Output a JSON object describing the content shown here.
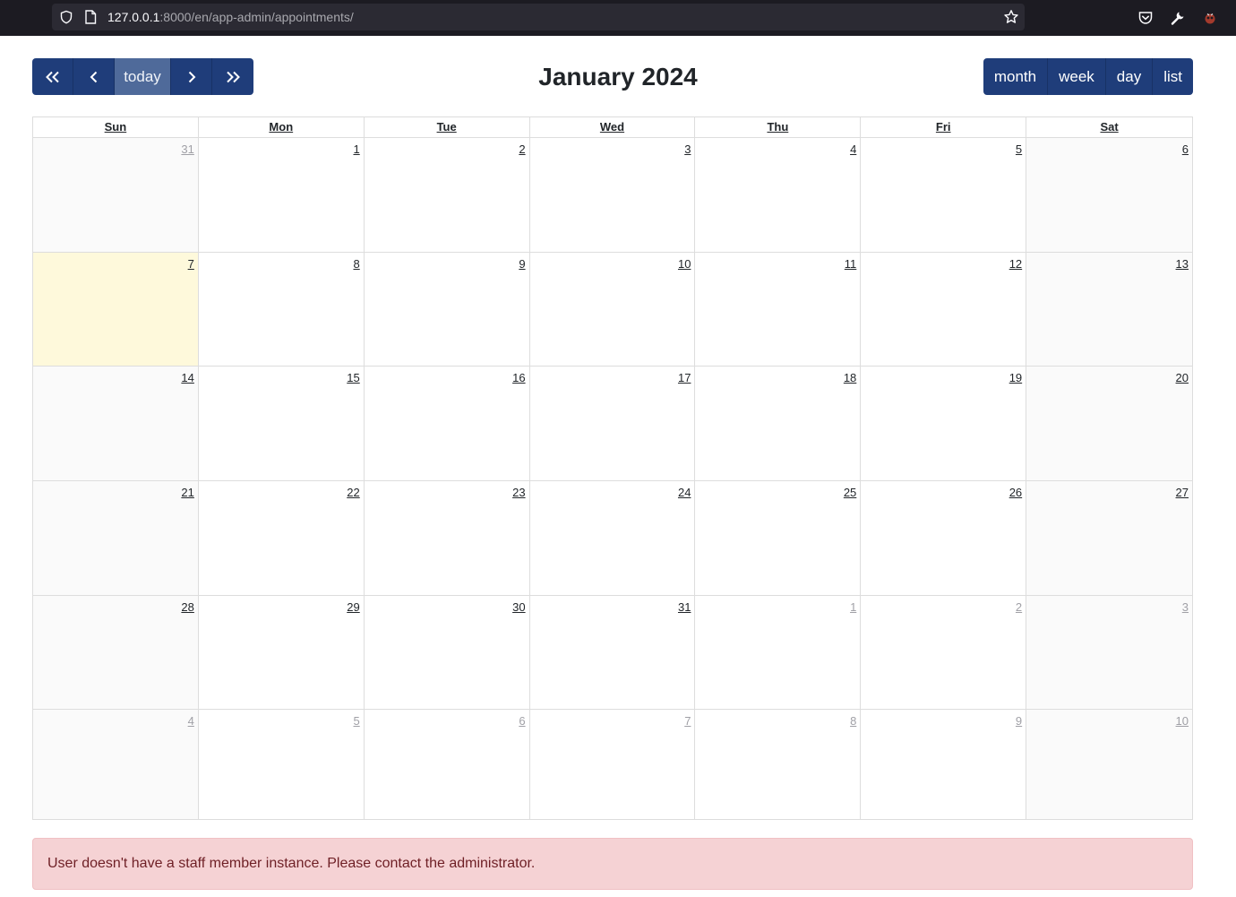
{
  "browser": {
    "url_host": "127.0.0.1",
    "url_path": ":8000/en/app-admin/appointments/"
  },
  "toolbar": {
    "prev_year_label": "«",
    "prev_label": "‹",
    "today_label": "today",
    "next_label": "›",
    "next_year_label": "»",
    "title": "January 2024",
    "views": [
      "month",
      "week",
      "day",
      "list"
    ]
  },
  "calendar": {
    "weekdays": [
      "Sun",
      "Mon",
      "Tue",
      "Wed",
      "Thu",
      "Fri",
      "Sat"
    ],
    "today": "7",
    "weeks": [
      [
        {
          "d": "31",
          "other": true
        },
        {
          "d": "1"
        },
        {
          "d": "2"
        },
        {
          "d": "3"
        },
        {
          "d": "4"
        },
        {
          "d": "5"
        },
        {
          "d": "6"
        }
      ],
      [
        {
          "d": "7",
          "today": true
        },
        {
          "d": "8"
        },
        {
          "d": "9"
        },
        {
          "d": "10"
        },
        {
          "d": "11"
        },
        {
          "d": "12"
        },
        {
          "d": "13"
        }
      ],
      [
        {
          "d": "14"
        },
        {
          "d": "15"
        },
        {
          "d": "16"
        },
        {
          "d": "17"
        },
        {
          "d": "18"
        },
        {
          "d": "19"
        },
        {
          "d": "20"
        }
      ],
      [
        {
          "d": "21"
        },
        {
          "d": "22"
        },
        {
          "d": "23"
        },
        {
          "d": "24"
        },
        {
          "d": "25"
        },
        {
          "d": "26"
        },
        {
          "d": "27"
        }
      ],
      [
        {
          "d": "28"
        },
        {
          "d": "29"
        },
        {
          "d": "30"
        },
        {
          "d": "31"
        },
        {
          "d": "1",
          "other": true
        },
        {
          "d": "2",
          "other": true
        },
        {
          "d": "3",
          "other": true
        }
      ],
      [
        {
          "d": "4",
          "other": true
        },
        {
          "d": "5",
          "other": true
        },
        {
          "d": "6",
          "other": true
        },
        {
          "d": "7",
          "other": true
        },
        {
          "d": "8",
          "other": true
        },
        {
          "d": "9",
          "other": true
        },
        {
          "d": "10",
          "other": true
        }
      ]
    ]
  },
  "alert": {
    "message": "User doesn't have a staff member instance. Please contact the administrator."
  },
  "colors": {
    "button": "#1f3d7a",
    "button_active": "#4f6a9a",
    "today_bg": "#fef9db",
    "alert_bg": "#f5d2d4",
    "alert_text": "#6e1f25"
  }
}
